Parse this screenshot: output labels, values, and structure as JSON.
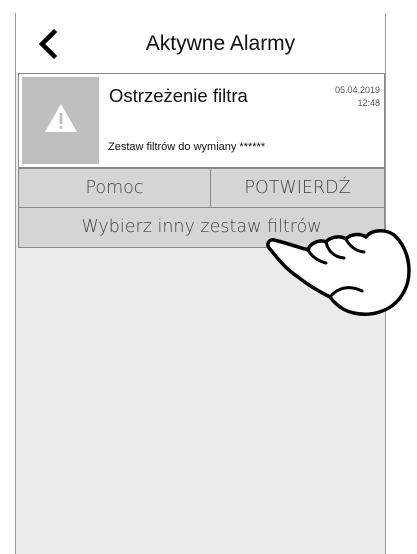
{
  "header": {
    "back_icon": "chevron-left-icon",
    "title": "Aktywne Alarmy"
  },
  "alarm": {
    "icon": "warning-triangle-icon",
    "title": "Ostrzeżenie filtra",
    "date": "05.04.2019",
    "time": "12:48",
    "description": "Zestaw filtrów do wymiany ******"
  },
  "buttons": {
    "help": "Pomoc",
    "confirm": "POTWIERDŹ",
    "select_filter_set": "Wybierz inny zestaw filtrów"
  },
  "overlay": {
    "pointer_icon": "hand-pointer-icon"
  },
  "colors": {
    "panel_bg": "#ebebeb",
    "button_bg": "#d5d5d5",
    "icon_box_bg": "#bfbfbf"
  }
}
